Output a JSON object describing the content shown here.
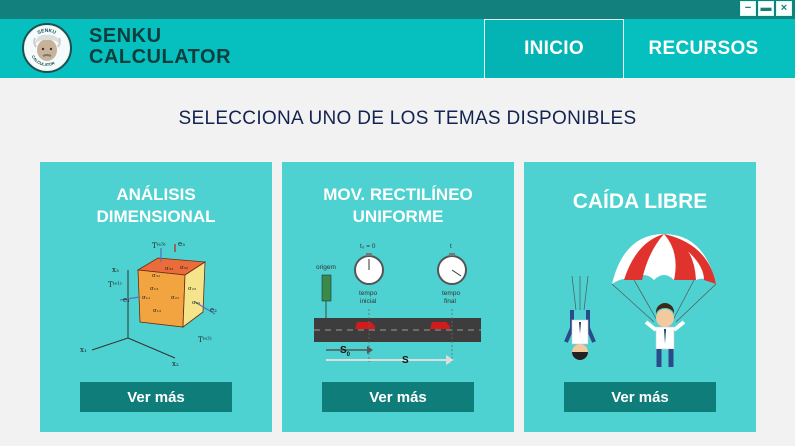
{
  "window": {
    "minimize_symbol": "−",
    "maximize_symbol": "▬",
    "close_symbol": "×"
  },
  "header": {
    "logo_text": "SENKU CALCULATOR",
    "brand_line1": "SENKU",
    "brand_line2": "CALCULATOR",
    "nav": [
      {
        "label": "INICIO"
      },
      {
        "label": "RECURSOS"
      }
    ]
  },
  "main": {
    "heading": "SELECCIONA UNO DE LOS TEMAS DISPONIBLES",
    "cards": [
      {
        "title_line1": "ANÁLISIS",
        "title_line2": "DIMENSIONAL",
        "button": "Ver más"
      },
      {
        "title_line1": "MOV. RECTILÍNEO",
        "title_line2": "UNIFORME",
        "button": "Ver más"
      },
      {
        "title": "CAÍDA LIBRE",
        "button": "Ver más"
      }
    ],
    "mru_labels": {
      "origin": "origem",
      "t0": "t₀ = 0",
      "t": "t",
      "start": "tempo",
      "start2": "inicial",
      "end": "tempo",
      "end2": "final",
      "s0": "S",
      "s0_sub": "0",
      "s": "S"
    },
    "cube_labels": {
      "x1": "x₁",
      "x2": "x₂",
      "x3": "x₃",
      "e1": "e₁",
      "e2": "e₂",
      "e3": "e₃",
      "T1": "T⁽ᵉ¹⁾",
      "T2": "T⁽ᵉ²⁾",
      "T3": "T⁽ᵉ³⁾",
      "s11": "σ₁₁",
      "s12": "σ₁₂",
      "s13": "σ₁₃",
      "s21": "σ₂₁",
      "s22": "σ₂₂",
      "s23": "σ₂₃",
      "s31": "σ₃₁",
      "s32": "σ₃₂",
      "s33": "σ₃₃"
    }
  }
}
